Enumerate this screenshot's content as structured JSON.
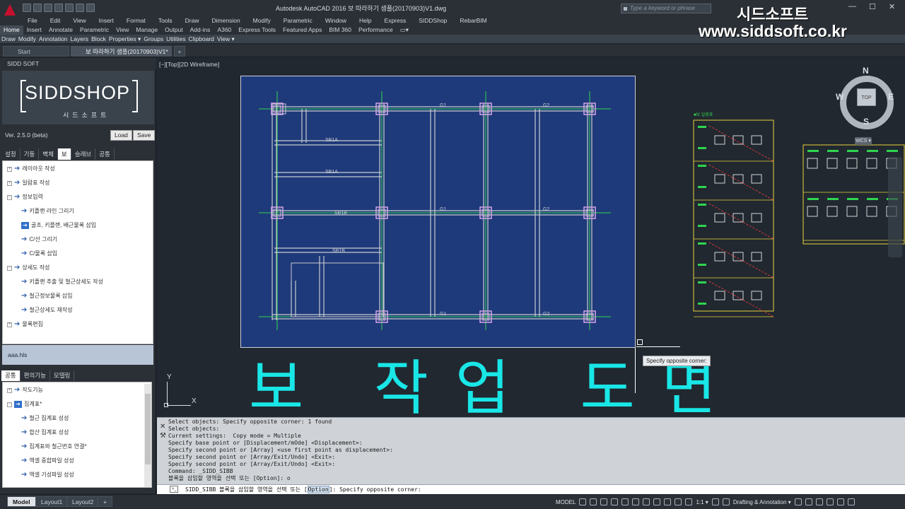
{
  "titlebar": {
    "window_title": "Autodesk AutoCAD 2016      보 따라하기 샘플(20170903)V1.dwg",
    "search_placeholder": "Type a keyword or phrase",
    "minimize": "—",
    "maximize": "☐",
    "close": "✕"
  },
  "menu": [
    "File",
    "Edit",
    "View",
    "Insert",
    "Format",
    "Tools",
    "Draw",
    "Dimension",
    "Modify",
    "Parametric",
    "Window",
    "Help",
    "Express",
    "SIDDShop",
    "RebarBIM"
  ],
  "ribbon_tabs": [
    "Home",
    "Insert",
    "Annotate",
    "Parametric",
    "View",
    "Manage",
    "Output",
    "Add-ins",
    "A360",
    "Express Tools",
    "Featured Apps",
    "BIM 360",
    "Performance"
  ],
  "ribbon_panels": [
    "Draw",
    "Modify",
    "Annotation",
    "Layers",
    "Block",
    "Properties ▾",
    "Groups",
    "Utilities",
    "Clipboard",
    "View ▾"
  ],
  "watermark": {
    "korean": "시드소프트",
    "url": "www.siddsoft.co.kr"
  },
  "file_tabs": {
    "start": "Start",
    "active": "보 따라하기 샘플(20170903)V1*",
    "new": "+"
  },
  "palette": {
    "header": "SIDD SOFT",
    "logo_text": "SIDDSHOP",
    "logo_sub": "시드소프트",
    "version": "Ver. 2.5.0 (beta)",
    "load_label": "Load",
    "save_label": "Save",
    "tabs_top": [
      "설정",
      "기둥",
      "벽체",
      "보",
      "슬래브",
      "공통"
    ],
    "tree1": [
      {
        "label": "레이아웃 작성",
        "level": 0,
        "expand": "+"
      },
      {
        "label": "일람표 작성",
        "level": 0,
        "expand": "+"
      },
      {
        "label": "정보입력",
        "level": 0,
        "expand": "−"
      },
      {
        "label": "키플랜 라인 그리기",
        "level": 1
      },
      {
        "label": "골조, 키플랜, 배근물록 삽입",
        "level": 1,
        "selected": true
      },
      {
        "label": "C/선 그리기",
        "level": 1
      },
      {
        "label": "C/물록 삽입",
        "level": 1
      },
      {
        "label": "상세도 작성",
        "level": 0,
        "expand": "−"
      },
      {
        "label": "키플랜 추출 및 철근상세도 작성",
        "level": 1
      },
      {
        "label": "철근정보물록 삽입",
        "level": 1
      },
      {
        "label": "철근상세도 재작성",
        "level": 1
      },
      {
        "label": "물록편집",
        "level": 0,
        "expand": "+"
      }
    ],
    "file_name": "aaa.hls",
    "tabs_bottom": [
      "공통",
      "편의기능",
      "모델링"
    ],
    "tree2": [
      {
        "label": "작도기능",
        "level": 0,
        "expand": "+"
      },
      {
        "label": "집계표*",
        "level": 0,
        "expand": "−",
        "selected": true
      },
      {
        "label": "철근 집계표 성성",
        "level": 1
      },
      {
        "label": "합산 집계표 성성",
        "level": 1
      },
      {
        "label": "집계표와 철근번호 연결*",
        "level": 1
      },
      {
        "label": "엑셀 중합파일 성성",
        "level": 1
      },
      {
        "label": "엑셀 기성파일 성성",
        "level": 1
      }
    ]
  },
  "drawing": {
    "viewport_label": "[−][Top][2D Wireframe]",
    "big_text": "보 작업 도면",
    "tooltip": "Specify opposite corner:",
    "ucs_x": "X",
    "ucs_y": "Y",
    "beam_labels": [
      "SB1A",
      "SB1A",
      "SB1B",
      "SB1B",
      "G1",
      "G2",
      "G1",
      "G2",
      "G1",
      "G2"
    ],
    "sheet_title": "■보 일람표"
  },
  "viewcube": {
    "north": "N",
    "south": "S",
    "east": "E",
    "west": "W",
    "top": "TOP",
    "wcs": "WCS ▾"
  },
  "command": {
    "history": [
      "Select objects: Specify opposite corner: 1 found",
      "Select objects:",
      "Current settings:  Copy mode = Multiple",
      "Specify base point or [Displacement/mOde] <Displacement>:",
      "Specify second point or [Array] <use first point as displacement>:",
      "Specify second point or [Array/Exit/Undo] <Exit>:",
      "Specify second point or [Array/Exit/Undo] <Exit>:",
      "Command: _SIDD_SIBB",
      "블록을 삽입할 영역을 선택 또는 [Option]: o"
    ],
    "input_prefix": "SIDD_SIBB 블록을 삽입할 영역을 선택 또는 [",
    "input_option": "Option",
    "input_suffix": "]: Specify opposite corner:"
  },
  "status": {
    "layout_tabs": [
      "Model",
      "Layout1",
      "Layout2",
      "+"
    ],
    "model_label": "MODEL",
    "scale": "1:1 ▾",
    "workspace": "Drafting & Annotation ▾"
  },
  "colors": {
    "grid_line": "#2fd54f",
    "beam": "#c8ccd0",
    "column": "#d6a8e8",
    "text_cyan": "#19e6e6",
    "plan_bg": "#1f3a7a",
    "sheet_line": "#e8d23a",
    "red_line": "#ff3a3a"
  }
}
